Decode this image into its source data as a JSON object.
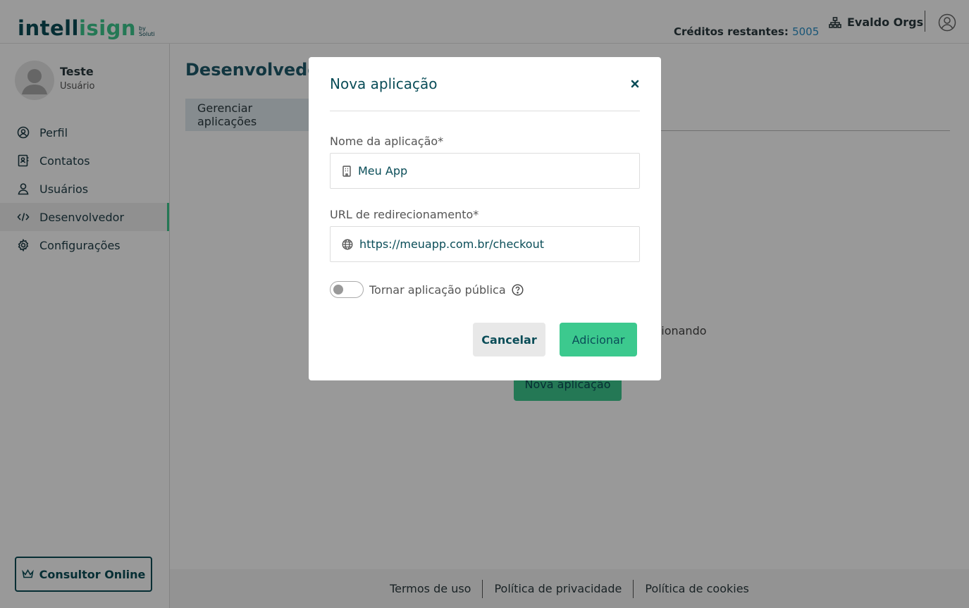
{
  "header": {
    "logo_main": "intell",
    "logo_accent": "isign",
    "logo_by": "by",
    "logo_brand": "Soluti",
    "credits_label": "Créditos restantes:",
    "credits_value": "5005",
    "org_name": "Evaldo Orgs"
  },
  "sidebar": {
    "user_name": "Teste",
    "user_role": "Usuário",
    "items": [
      {
        "label": "Perfil",
        "icon": "user-circle-icon"
      },
      {
        "label": "Contatos",
        "icon": "contacts-book-icon"
      },
      {
        "label": "Usuários",
        "icon": "user-icon"
      },
      {
        "label": "Desenvolvedor",
        "icon": "code-icon",
        "active": true
      },
      {
        "label": "Configurações",
        "icon": "gear-icon"
      }
    ],
    "consultor_label": "Consultor Online"
  },
  "main": {
    "page_title": "Desenvolvedor",
    "tab_label": "Gerenciar aplicações",
    "bg_text_fragment": "icionando",
    "bg_button_label": "Nova aplicação"
  },
  "footer": {
    "links": [
      "Termos de uso",
      "Política de privacidade",
      "Política de cookies"
    ]
  },
  "modal": {
    "title": "Nova aplicação",
    "name_label": "Nome da aplicação*",
    "name_value": "Meu App",
    "url_label": "URL de redirecionamento*",
    "url_value": "https://meuapp.com.br/checkout",
    "toggle_label": "Tornar aplicação pública",
    "toggle_on": false,
    "cancel_label": "Cancelar",
    "add_label": "Adicionar"
  },
  "colors": {
    "brand_dark": "#0a4d58",
    "brand_green": "#3cc98e",
    "credits_blue": "#2a8fc6"
  }
}
